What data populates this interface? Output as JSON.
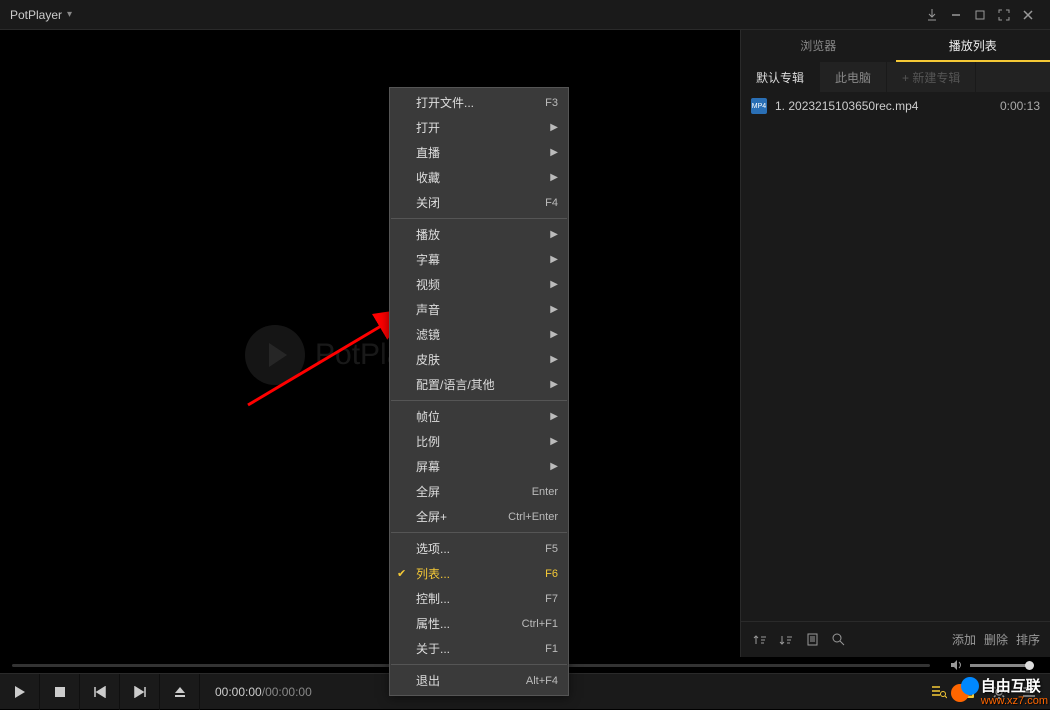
{
  "titlebar": {
    "app_name": "PotPlayer"
  },
  "logo_text": "PotPlayer",
  "context_menu": [
    {
      "label": "打开文件...",
      "shortcut": "F3",
      "submenu": false
    },
    {
      "label": "打开",
      "submenu": true
    },
    {
      "label": "直播",
      "submenu": true
    },
    {
      "label": "收藏",
      "submenu": true
    },
    {
      "label": "关闭",
      "shortcut": "F4",
      "submenu": false
    },
    {
      "sep": true
    },
    {
      "label": "播放",
      "submenu": true
    },
    {
      "label": "字幕",
      "submenu": true
    },
    {
      "label": "视频",
      "submenu": true
    },
    {
      "label": "声音",
      "submenu": true
    },
    {
      "label": "滤镜",
      "submenu": true
    },
    {
      "label": "皮肤",
      "submenu": true
    },
    {
      "label": "配置/语言/其他",
      "submenu": true
    },
    {
      "sep": true
    },
    {
      "label": "帧位",
      "submenu": true
    },
    {
      "label": "比例",
      "submenu": true
    },
    {
      "label": "屏幕",
      "submenu": true
    },
    {
      "label": "全屏",
      "shortcut": "Enter",
      "submenu": false
    },
    {
      "label": "全屏+",
      "shortcut": "Ctrl+Enter",
      "submenu": false
    },
    {
      "sep": true
    },
    {
      "label": "选项...",
      "shortcut": "F5",
      "submenu": false
    },
    {
      "label": "列表...",
      "shortcut": "F6",
      "submenu": false,
      "checked": true,
      "active": true
    },
    {
      "label": "控制...",
      "shortcut": "F7",
      "submenu": false
    },
    {
      "label": "属性...",
      "shortcut": "Ctrl+F1",
      "submenu": false
    },
    {
      "label": "关于...",
      "shortcut": "F1",
      "submenu": false
    },
    {
      "sep": true
    },
    {
      "label": "退出",
      "shortcut": "Alt+F4",
      "submenu": false
    }
  ],
  "side_tabs": {
    "browser": "浏览器",
    "playlist": "播放列表"
  },
  "playlist_tabs": {
    "default_album": "默认专辑",
    "this_pc": "此电脑",
    "new_album": "+ 新建专辑"
  },
  "playlist_items": [
    {
      "icon": "MP4",
      "name": "1. 2023215103650rec.mp4",
      "duration": "0:00:13"
    }
  ],
  "controls": {
    "time_current": "00:00:00",
    "time_sep": " / ",
    "time_total": "00:00:00"
  },
  "side_footer": {
    "add": "添加",
    "remove": "删除",
    "sort": "排序"
  },
  "watermark": {
    "text1": "自由互联",
    "text2": "www.xz7.com"
  }
}
